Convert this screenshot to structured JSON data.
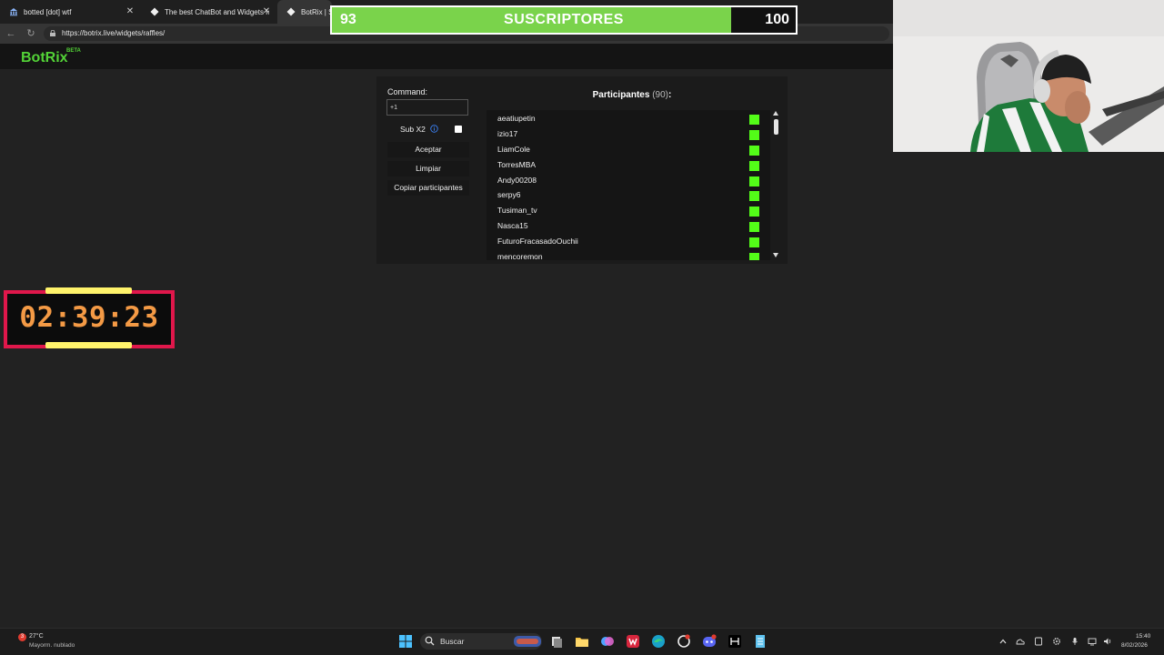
{
  "browser": {
    "tabs": [
      {
        "label": "botted [dot] wtf"
      },
      {
        "label": "The best ChatBot and Widgets for"
      },
      {
        "label": "BotRix | Sor"
      }
    ],
    "url": "https://botrix.live/widgets/raffles/"
  },
  "page": {
    "logo": "BotRix",
    "logo_badge": "BETA",
    "command_label": "Command:",
    "command_value": "+1",
    "sub_label": "Sub X2",
    "sub_checked": false,
    "buttons": {
      "accept": "Aceptar",
      "clear": "Limpiar",
      "copy": "Copiar participantes"
    },
    "participants_title": "Participantes",
    "participants_count": "(90)",
    "participants_colon": ":",
    "participants": [
      "aeatiupetin",
      "izio17",
      "LiamCole",
      "TorresMBA",
      "Andy00208",
      "serpy6",
      "Tusiman_tv",
      "Nasca15",
      "FuturoFracasadoOuchii",
      "mencoremon"
    ],
    "platform_icon": "kick-icon",
    "colors": {
      "brand": "#53d337",
      "kick": "#53fc18"
    }
  },
  "overlay": {
    "goal_current": "93",
    "goal_title": "SUSCRIPTORES",
    "goal_max": "100",
    "goal_progress": 0.93,
    "timer": "02:39:23",
    "colors": {
      "goal_fill": "#7ad34b",
      "timer_border": "#e0174b",
      "timer_text": "#f49a45",
      "timer_accent": "#fff36b"
    }
  },
  "taskbar": {
    "weather_badge": "3",
    "weather_temp": "27°C",
    "weather_desc": "Mayorm. nublado",
    "search_label": "Buscar",
    "time": "15:40",
    "date": "8/02/2026"
  }
}
